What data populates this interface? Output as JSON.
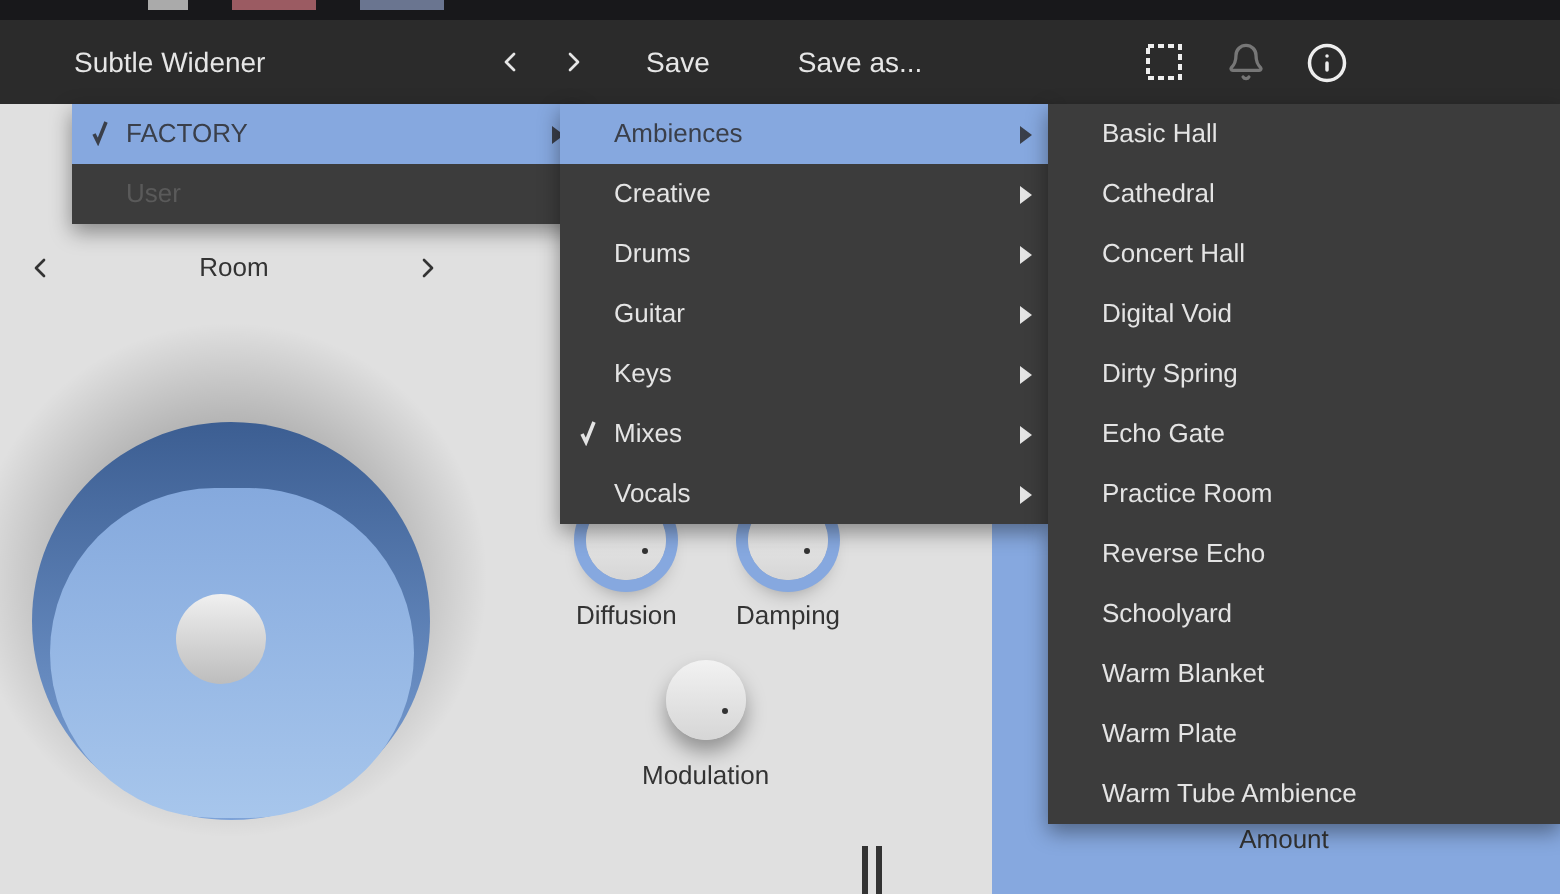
{
  "header": {
    "preset_name": "Subtle Widener",
    "save": "Save",
    "save_as": "Save as..."
  },
  "room": {
    "label": "Room"
  },
  "knobs": [
    {
      "kind": "ring",
      "label": "Diffusion"
    },
    {
      "kind": "ring",
      "label": "Damping"
    },
    {
      "kind": "plain",
      "label": "Modulation"
    }
  ],
  "amount": {
    "label": "Amount"
  },
  "menus": [
    [
      {
        "label": "FACTORY",
        "checked": true,
        "selected": true,
        "submenu": true
      },
      {
        "label": "User",
        "checked": false,
        "selected": false,
        "submenu": false,
        "disabled": true
      }
    ],
    [
      {
        "label": "Ambiences",
        "checked": false,
        "selected": true,
        "submenu": true
      },
      {
        "label": "Creative",
        "checked": false,
        "selected": false,
        "submenu": true
      },
      {
        "label": "Drums",
        "checked": false,
        "selected": false,
        "submenu": true
      },
      {
        "label": "Guitar",
        "checked": false,
        "selected": false,
        "submenu": true
      },
      {
        "label": "Keys",
        "checked": false,
        "selected": false,
        "submenu": true
      },
      {
        "label": "Mixes",
        "checked": true,
        "selected": false,
        "submenu": true
      },
      {
        "label": "Vocals",
        "checked": false,
        "selected": false,
        "submenu": true
      }
    ],
    [
      {
        "label": "Basic Hall",
        "checked": false,
        "selected": false,
        "submenu": false
      },
      {
        "label": "Cathedral",
        "checked": false,
        "selected": false,
        "submenu": false
      },
      {
        "label": "Concert Hall",
        "checked": false,
        "selected": false,
        "submenu": false
      },
      {
        "label": "Digital Void",
        "checked": false,
        "selected": false,
        "submenu": false
      },
      {
        "label": "Dirty Spring",
        "checked": false,
        "selected": false,
        "submenu": false
      },
      {
        "label": "Echo Gate",
        "checked": false,
        "selected": false,
        "submenu": false
      },
      {
        "label": "Practice Room",
        "checked": false,
        "selected": false,
        "submenu": false
      },
      {
        "label": "Reverse Echo",
        "checked": false,
        "selected": false,
        "submenu": false
      },
      {
        "label": "Schoolyard",
        "checked": false,
        "selected": false,
        "submenu": false
      },
      {
        "label": "Warm Blanket",
        "checked": false,
        "selected": false,
        "submenu": false
      },
      {
        "label": "Warm Plate",
        "checked": false,
        "selected": false,
        "submenu": false
      },
      {
        "label": "Warm Tube Ambience",
        "checked": false,
        "selected": false,
        "submenu": false
      }
    ]
  ]
}
